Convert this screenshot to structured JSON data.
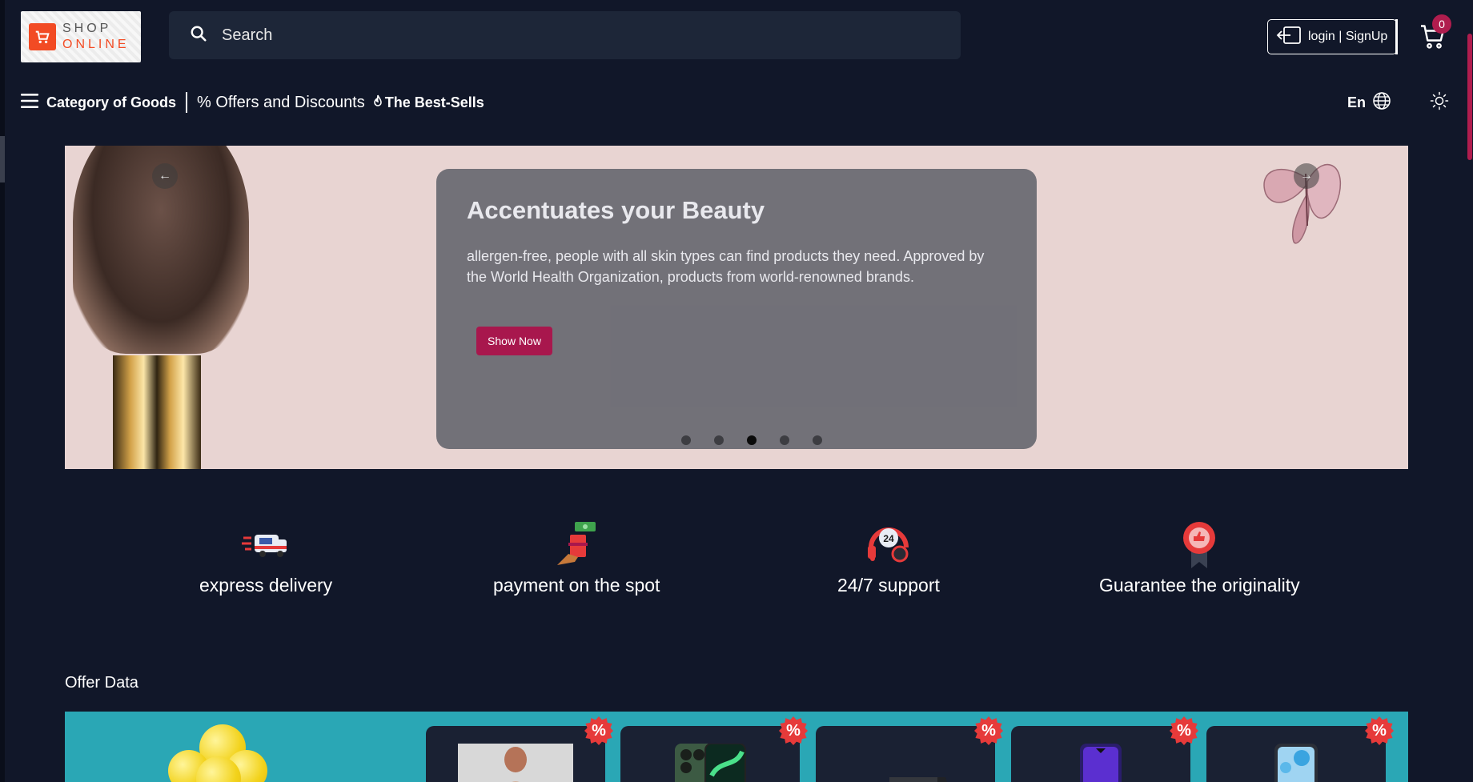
{
  "header": {
    "logo": {
      "line1": "SHOP",
      "line2": "ONLINE"
    },
    "search": {
      "placeholder": "Search"
    },
    "login_label": "login | SignUp",
    "cart_count": "0"
  },
  "nav": {
    "category_label": "Category of Goods",
    "offers_label": "% Offers and Discounts",
    "bestsells_label": "The Best-Sells",
    "language": "En"
  },
  "hero": {
    "title": "Accentuates your Beauty",
    "description": "allergen-free, people with all skin types can find products they need. Approved by the World Health Organization, products from world-renowned brands.",
    "button_label": "Show Now",
    "slide_count": 5,
    "active_slide": 3,
    "prev_icon": "arrow-left-icon",
    "next_icon": "arrow-right-icon"
  },
  "features": [
    {
      "label": "express delivery",
      "icon": "delivery-truck-icon"
    },
    {
      "label": "payment on the spot",
      "icon": "cash-payment-icon"
    },
    {
      "label": "24/7 support",
      "icon": "support-headset-icon"
    },
    {
      "label": "Guarantee the originality",
      "icon": "quality-badge-icon"
    }
  ],
  "offers": {
    "title": "Offer Data",
    "discount_badge": "%",
    "cards": [
      {
        "icon": "clothing-product-image"
      },
      {
        "icon": "phone-green-product-image"
      },
      {
        "icon": "black-device-product-image"
      },
      {
        "icon": "phone-purple-product-image"
      },
      {
        "icon": "phone-blue-product-image"
      }
    ]
  },
  "colors": {
    "background": "#111729",
    "accent": "#a8174d",
    "offer_band": "#2aa7b5",
    "discount_badge": "#e63a3a"
  }
}
